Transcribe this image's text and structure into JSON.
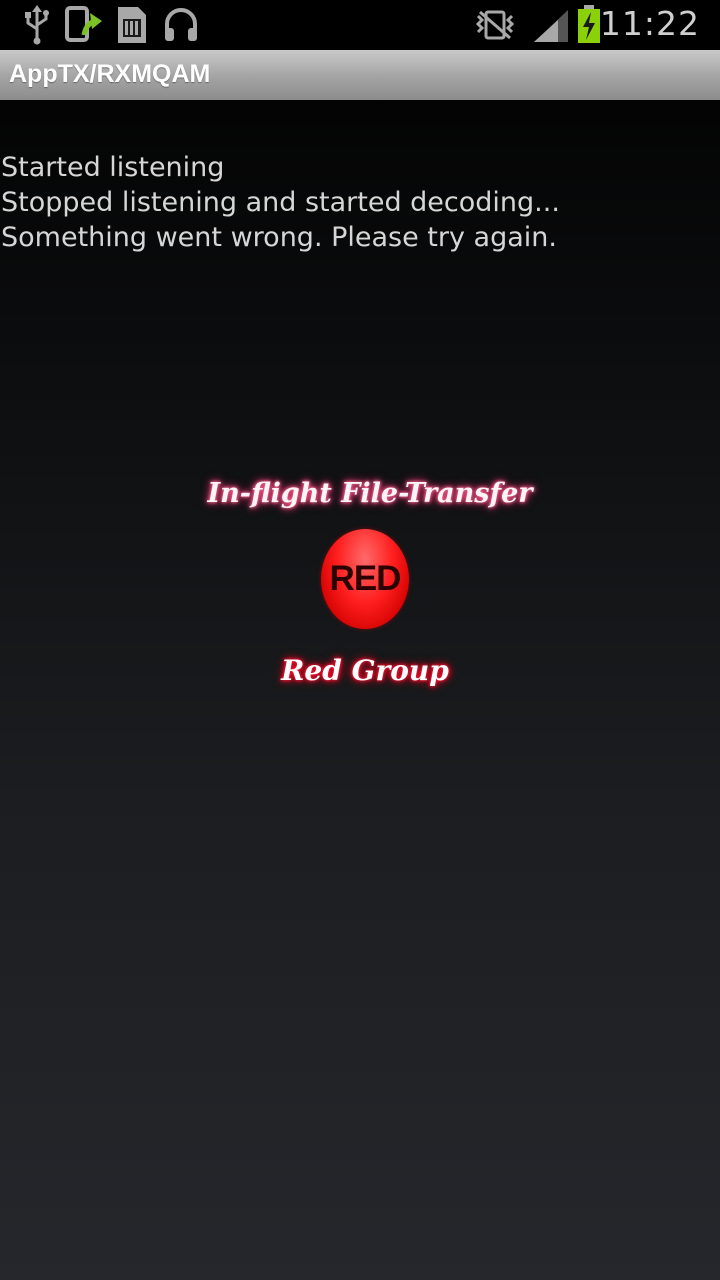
{
  "status_bar": {
    "time": "11:22",
    "icons": [
      "usb-icon",
      "upload-icon",
      "sd-card-icon",
      "headset-icon",
      "vibrate-icon",
      "signal-icon",
      "battery-charging-icon"
    ],
    "battery_color": "#8ad10a"
  },
  "app": {
    "title": "AppTX/RXMQAM"
  },
  "log": {
    "lines": [
      "Started listening",
      "Stopped listening and started decoding...",
      "Something went wrong. Please try again."
    ]
  },
  "center": {
    "top_caption": "In-flight File-Transfer",
    "button_label": "RED",
    "bottom_caption": "Red Group",
    "accent_color": "#ff1f1f",
    "glow_top_color": "#ff4f86"
  }
}
